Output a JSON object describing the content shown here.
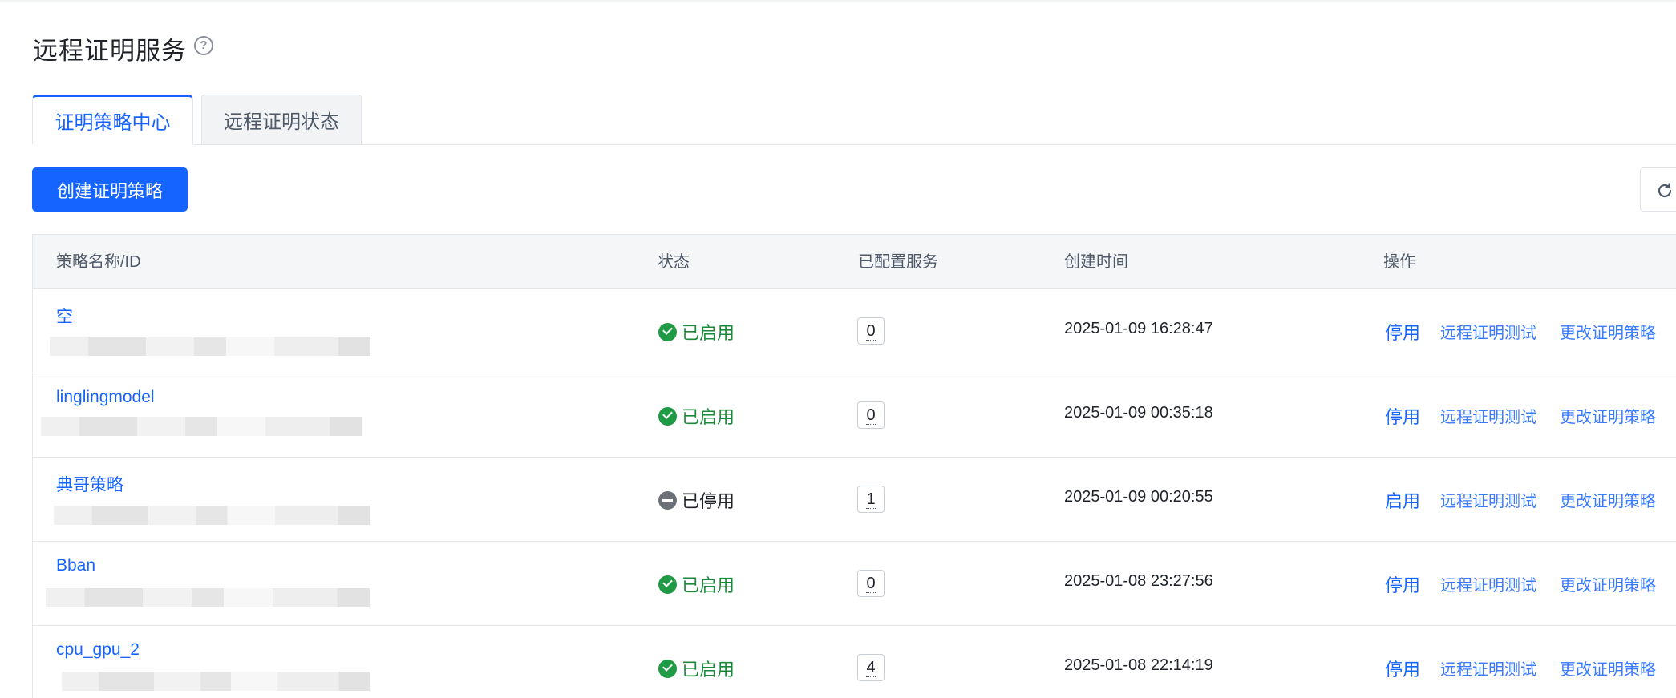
{
  "header": {
    "title": "远程证明服务"
  },
  "tabs": [
    {
      "label": "证明策略中心",
      "active": true
    },
    {
      "label": "远程证明状态",
      "active": false
    }
  ],
  "toolbar": {
    "create_label": "创建证明策略"
  },
  "table": {
    "columns": [
      "策略名称/ID",
      "状态",
      "已配置服务",
      "创建时间",
      "操作"
    ],
    "rows": [
      {
        "name": "空",
        "status": "已启用",
        "enabled": true,
        "services": "0",
        "created": "2025-01-09 16:28:47",
        "action": "停用",
        "test": "远程证明测试",
        "edit": "更改证明策略"
      },
      {
        "name": "linglingmodel",
        "status": "已启用",
        "enabled": true,
        "services": "0",
        "created": "2025-01-09 00:35:18",
        "action": "停用",
        "test": "远程证明测试",
        "edit": "更改证明策略"
      },
      {
        "name": "典哥策略",
        "status": "已停用",
        "enabled": false,
        "services": "1",
        "created": "2025-01-09 00:20:55",
        "action": "启用",
        "test": "远程证明测试",
        "edit": "更改证明策略"
      },
      {
        "name": "Bban",
        "status": "已启用",
        "enabled": true,
        "services": "0",
        "created": "2025-01-08 23:27:56",
        "action": "停用",
        "test": "远程证明测试",
        "edit": "更改证明策略"
      },
      {
        "name": "cpu_gpu_2",
        "status": "已启用",
        "enabled": true,
        "services": "4",
        "created": "2025-01-08 22:14:19",
        "action": "停用",
        "test": "远程证明测试",
        "edit": "更改证明策略"
      }
    ]
  },
  "colors": {
    "primary": "#1664ff",
    "enabled": "#1f9a45",
    "disabled": "#6b7079"
  },
  "icons": {
    "help": "question-circle-icon",
    "refresh": "refresh-icon",
    "enabled": "check-circle-icon",
    "disabled": "minus-circle-icon"
  }
}
